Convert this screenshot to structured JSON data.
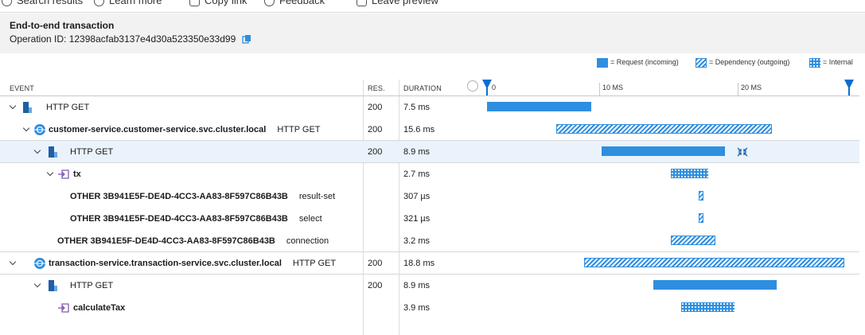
{
  "toolbar": {
    "items": [
      {
        "label": "Search results",
        "icon": "search-icon"
      },
      {
        "label": "Learn more",
        "icon": "help-icon"
      },
      {
        "label": "Copy link",
        "icon": "copy-icon"
      },
      {
        "label": "Feedback",
        "icon": "feedback-icon"
      },
      {
        "label": "Leave preview",
        "icon": "back-arrow-icon"
      }
    ]
  },
  "header": {
    "title": "End-to-end transaction",
    "operation_id": "Operation ID: 12398acfab3137e4d30a523350e33d99"
  },
  "legend": {
    "request": "= Request (incoming)",
    "dependency": "= Dependency (outgoing)",
    "internal": "= Internal"
  },
  "columns": {
    "event": "EVENT",
    "result": "RES.",
    "duration": "DURATION"
  },
  "timeline": {
    "tick0": "0",
    "tick1": "10 MS",
    "tick2": "20 MS"
  },
  "colors": {
    "accent": "#2f8ee0",
    "marker": "#0a6ed1",
    "selected_row": "#eaf3fb"
  },
  "rows": [
    {
      "name": "HTTP GET",
      "detail": "",
      "result": "200",
      "duration": "7.5 ms",
      "icon": "server-icon",
      "type": "request",
      "start_ms": 0.0,
      "length_ms": 7.5
    },
    {
      "name": "customer-service.customer-service.svc.cluster.local",
      "detail": "HTTP GET",
      "result": "200",
      "duration": "15.6 ms",
      "icon": "globe-icon",
      "type": "dependency",
      "start_ms": 5.0,
      "length_ms": 15.6
    },
    {
      "name": "HTTP GET",
      "detail": "",
      "result": "200",
      "duration": "8.9 ms",
      "icon": "server-icon",
      "type": "request",
      "start_ms": 8.3,
      "length_ms": 8.9
    },
    {
      "name": "tx",
      "detail": "",
      "result": "",
      "duration": "2.7 ms",
      "icon": "internal-icon",
      "type": "internal",
      "start_ms": 13.3,
      "length_ms": 2.7
    },
    {
      "name": "OTHER 3B941E5F-DE4D-4CC3-AA83-8F597C86B43B",
      "detail": "result-set",
      "result": "",
      "duration": "307 µs",
      "icon": "",
      "type": "dependency",
      "start_ms": 15.3,
      "length_ms": 0.307
    },
    {
      "name": "OTHER 3B941E5F-DE4D-4CC3-AA83-8F597C86B43B",
      "detail": "select",
      "result": "",
      "duration": "321 µs",
      "icon": "",
      "type": "dependency",
      "start_ms": 15.3,
      "length_ms": 0.321
    },
    {
      "name": "OTHER 3B941E5F-DE4D-4CC3-AA83-8F597C86B43B",
      "detail": "connection",
      "result": "",
      "duration": "3.2 ms",
      "icon": "",
      "type": "dependency",
      "start_ms": 13.3,
      "length_ms": 3.2
    },
    {
      "name": "transaction-service.transaction-service.svc.cluster.local",
      "detail": "HTTP GET",
      "result": "200",
      "duration": "18.8 ms",
      "icon": "globe-icon",
      "type": "dependency",
      "start_ms": 7.0,
      "length_ms": 18.8
    },
    {
      "name": "HTTP GET",
      "detail": "",
      "result": "200",
      "duration": "8.9 ms",
      "icon": "server-icon",
      "type": "request",
      "start_ms": 12.0,
      "length_ms": 8.9
    },
    {
      "name": "calculateTax",
      "detail": "",
      "result": "",
      "duration": "3.9 ms",
      "icon": "internal-icon",
      "type": "internal",
      "start_ms": 14.0,
      "length_ms": 3.9
    }
  ]
}
